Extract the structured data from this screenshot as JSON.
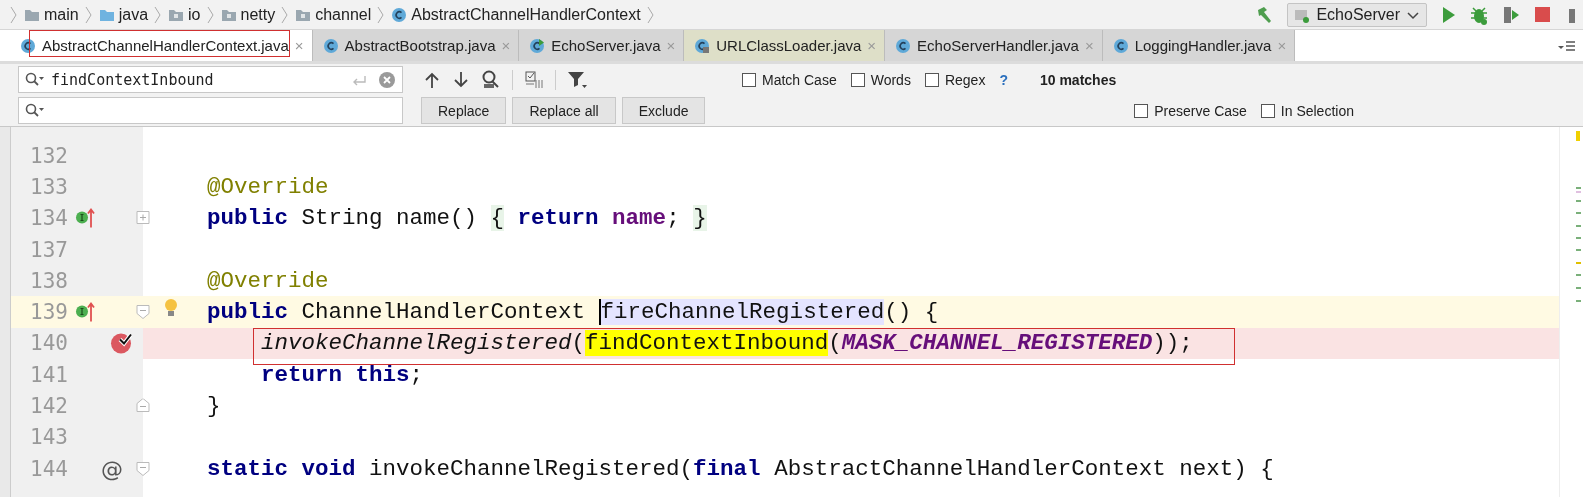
{
  "breadcrumb": [
    {
      "label": "main",
      "kind": "folder"
    },
    {
      "label": "java",
      "kind": "source-folder"
    },
    {
      "label": "io",
      "kind": "package"
    },
    {
      "label": "netty",
      "kind": "package"
    },
    {
      "label": "channel",
      "kind": "package"
    },
    {
      "label": "AbstractChannelHandlerContext",
      "kind": "class"
    }
  ],
  "toolbar": {
    "run_config": "EchoServer"
  },
  "tabs": [
    {
      "label": "AbstractChannelHandlerContext.java",
      "close": "×",
      "kind": "class",
      "selected": true,
      "marked": true
    },
    {
      "label": "AbstractBootstrap.java",
      "close": "×",
      "kind": "class",
      "selected": false
    },
    {
      "label": "EchoServer.java",
      "close": "×",
      "kind": "runnable",
      "selected": false
    },
    {
      "label": "URLClassLoader.java",
      "close": "×",
      "kind": "library",
      "selected": false
    },
    {
      "label": "EchoServerHandler.java",
      "close": "×",
      "kind": "class",
      "selected": false
    },
    {
      "label": "LoggingHandler.java",
      "close": "×",
      "kind": "class",
      "selected": false
    }
  ],
  "find": {
    "search_value": "findContextInbound",
    "options": [
      {
        "label": "Match Case",
        "checked": false
      },
      {
        "label": "Words",
        "checked": false
      },
      {
        "label": "Regex",
        "checked": false
      }
    ],
    "help": "?",
    "match_count": "10 matches",
    "buttons": [
      "Replace",
      "Replace all",
      "Exclude"
    ],
    "replace_options": [
      {
        "label": "Preserve Case",
        "checked": false
      },
      {
        "label": "In Selection",
        "checked": false
      }
    ]
  },
  "editor": {
    "lines": [
      {
        "number": "132",
        "kind": "plain"
      },
      {
        "number": "133",
        "kind": "plain",
        "segments": [
          {
            "text": "    @Override",
            "kind": "annotation"
          }
        ]
      },
      {
        "number": "134",
        "kind": "plain",
        "implements": true,
        "collapsed": true,
        "segments": [
          {
            "text": "    public",
            "kind": "keyword"
          },
          {
            "text": " String name() ",
            "kind": "plain"
          },
          {
            "text": "{",
            "kind": "folded"
          },
          {
            "text": " return",
            "kind": "keyword"
          },
          {
            "text": " name",
            "kind": "field"
          },
          {
            "text": "; ",
            "kind": "plain"
          },
          {
            "text": "}",
            "kind": "folded"
          }
        ]
      },
      {
        "number": "137",
        "kind": "plain"
      },
      {
        "number": "138",
        "kind": "plain",
        "segments": [
          {
            "text": "    @Override",
            "kind": "annotation"
          }
        ]
      },
      {
        "number": "139",
        "kind": "current",
        "implements": true,
        "fold_start": true,
        "bulb": true,
        "segments": [
          {
            "text": "    public",
            "kind": "keyword"
          },
          {
            "text": " ChannelHandlerContext ",
            "kind": "plain"
          },
          {
            "text": "fireChannelRegistered",
            "kind": "usage",
            "caret": true
          },
          {
            "text": "() {",
            "kind": "plain"
          }
        ]
      },
      {
        "number": "140",
        "kind": "breakpoint",
        "marked": true,
        "segments": [
          {
            "text": "        invokeChannelRegistered",
            "kind": "static-call"
          },
          {
            "text": "(",
            "kind": "plain"
          },
          {
            "text": "findContextInbound",
            "kind": "match"
          },
          {
            "text": "(",
            "kind": "plain"
          },
          {
            "text": "MASK_CHANNEL_REGISTERED",
            "kind": "constant"
          },
          {
            "text": "));",
            "kind": "plain"
          }
        ]
      },
      {
        "number": "141",
        "kind": "plain",
        "segments": [
          {
            "text": "        return",
            "kind": "keyword"
          },
          {
            "text": " this",
            "kind": "keyword"
          },
          {
            "text": ";",
            "kind": "plain"
          }
        ]
      },
      {
        "number": "142",
        "kind": "plain",
        "fold_end": true,
        "segments": [
          {
            "text": "    }",
            "kind": "plain"
          }
        ]
      },
      {
        "number": "143",
        "kind": "plain"
      },
      {
        "number": "144",
        "kind": "plain",
        "gutter_text": "@",
        "fold_start": true,
        "segments": [
          {
            "text": "    static",
            "kind": "keyword"
          },
          {
            "text": " void",
            "kind": "keyword"
          },
          {
            "text": " invokeChannelRegistered(",
            "kind": "plain"
          },
          {
            "text": "final",
            "kind": "keyword"
          },
          {
            "text": " AbstractChannelHandlerContext next) {",
            "kind": "plain"
          }
        ]
      }
    ]
  }
}
